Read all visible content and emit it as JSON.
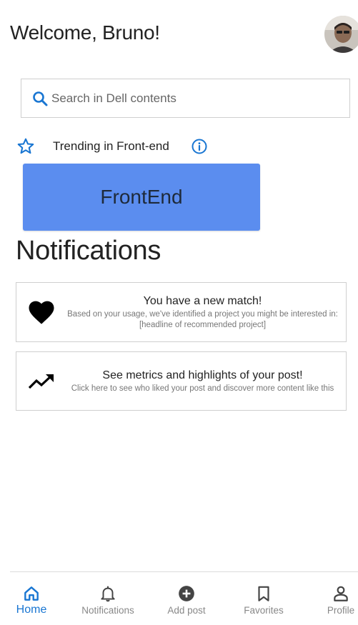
{
  "header": {
    "welcome": "Welcome, Bruno!"
  },
  "search": {
    "placeholder": "Search in Dell contents"
  },
  "trending": {
    "label": "Trending in Front-end"
  },
  "topic_card": {
    "label": "FrontEnd"
  },
  "notifications": {
    "title": "Notifications",
    "items": [
      {
        "icon": "heart-icon",
        "title": "You have a new match!",
        "body": "Based on your usage, we've identified a project you might be interested in: [headline of recommended project]"
      },
      {
        "icon": "trending-up-icon",
        "title": "See metrics and highlights of your post!",
        "body": "Click here to see who liked your post and discover more content like this"
      }
    ]
  },
  "bottom_nav": {
    "items": [
      {
        "label": "Home",
        "icon": "home-icon",
        "active": true
      },
      {
        "label": "Notifications",
        "icon": "bell-icon",
        "active": false
      },
      {
        "label": "Add post",
        "icon": "add-circle-icon",
        "active": false
      },
      {
        "label": "Favorites",
        "icon": "bookmark-icon",
        "active": false
      },
      {
        "label": "Profile",
        "icon": "person-icon",
        "active": false
      }
    ]
  },
  "colors": {
    "accent": "#1976d2",
    "topic_card": "#5b8def",
    "nav_inactive": "#888888",
    "border": "#cfcfcf"
  }
}
